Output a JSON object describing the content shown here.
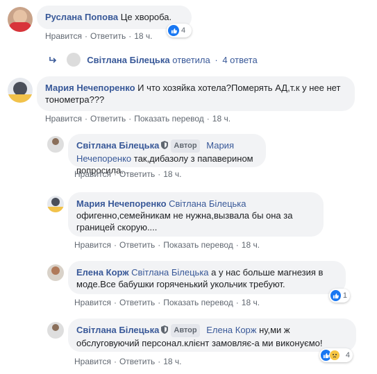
{
  "actions": {
    "like": "Нравится",
    "reply": "Ответить",
    "translate": "Показать перевод",
    "sep": "·",
    "author_badge": "Автор"
  },
  "comments": [
    {
      "author": "Руслана Попова",
      "text": "Це хвороба.",
      "time": "18 ч.",
      "reactions": "4"
    },
    {
      "replies_author": "Світлана Білецька",
      "replies_text": "ответила",
      "replies_count": "4 ответа"
    },
    {
      "author": "Мария Нечепоренко",
      "text": "И что хозяйка хотела?Померять АД,т.к у нее нет тонометра???",
      "time": "18 ч."
    },
    {
      "author": "Світлана Білецька",
      "tag": "Мария Нечепоренко",
      "text": "так,дибазолу з папаверином попросила...",
      "time": "18 ч."
    },
    {
      "author": "Мария Нечепоренко",
      "tag": "Світлана Білецька",
      "text": "офигенно,семейникам не нужна,вызвала бы она за границей скорую....",
      "time": "18 ч."
    },
    {
      "author": "Елена Корж",
      "tag": "Світлана Білецька",
      "text": "а у нас больше магнезия в моде.Все бабушки горяченький укольчик требуют.",
      "time": "18 ч.",
      "reactions": "1"
    },
    {
      "author": "Світлана Білецька",
      "tag": "Елена Корж",
      "text": "ну,ми ж обслуговуючий персонал.клієнт замовляє-а ми виконуємо!",
      "time": "18 ч.",
      "reactions": "4"
    }
  ],
  "colors": {
    "link": "#385898",
    "bubble": "#f2f3f5",
    "like": "#1877f2"
  }
}
